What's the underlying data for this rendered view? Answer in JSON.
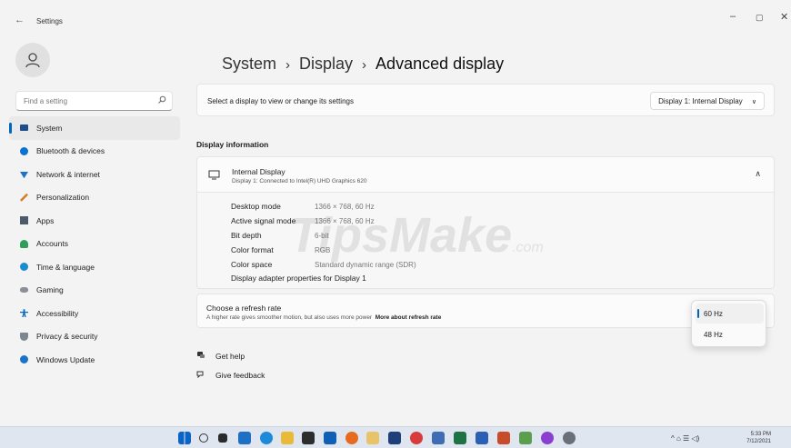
{
  "window": {
    "back": "←",
    "title": "Settings",
    "controls": {
      "minimize": "–",
      "maximize": "▢",
      "close": "✕"
    }
  },
  "search": {
    "placeholder": "Find a setting"
  },
  "sidebar": {
    "items": [
      {
        "label": "System",
        "icon": "monitor-icon",
        "color": "#1f4e8c"
      },
      {
        "label": "Bluetooth & devices",
        "icon": "bluetooth-icon",
        "color": "#0a72d1"
      },
      {
        "label": "Network & internet",
        "icon": "wifi-icon",
        "color": "#1a73c9"
      },
      {
        "label": "Personalization",
        "icon": "brush-icon",
        "color": "#d67d2a"
      },
      {
        "label": "Apps",
        "icon": "apps-icon",
        "color": "#4d5a6b"
      },
      {
        "label": "Accounts",
        "icon": "person-icon",
        "color": "#2e9e5c"
      },
      {
        "label": "Time & language",
        "icon": "globe-icon",
        "color": "#1b8ad1"
      },
      {
        "label": "Gaming",
        "icon": "controller-icon",
        "color": "#8a8f98"
      },
      {
        "label": "Accessibility",
        "icon": "accessibility-icon",
        "color": "#0067c0"
      },
      {
        "label": "Privacy & security",
        "icon": "shield-icon",
        "color": "#7d8590"
      },
      {
        "label": "Windows Update",
        "icon": "update-icon",
        "color": "#1a73c9"
      }
    ]
  },
  "breadcrumb": {
    "parts": [
      "System",
      "Display",
      "Advanced display"
    ],
    "separator": "›"
  },
  "select_display": {
    "label": "Select a display to view or change its settings",
    "value": "Display 1: Internal Display"
  },
  "display_info": {
    "section_title": "Display information",
    "name": "Internal Display",
    "subtitle": "Display 1: Connected to Intel(R) UHD Graphics 620",
    "rows": [
      {
        "key": "Desktop mode",
        "value": "1366 × 768, 60 Hz"
      },
      {
        "key": "Active signal mode",
        "value": "1366 × 768, 60 Hz"
      },
      {
        "key": "Bit depth",
        "value": "6-bit"
      },
      {
        "key": "Color format",
        "value": "RGB"
      },
      {
        "key": "Color space",
        "value": "Standard dynamic range (SDR)"
      }
    ],
    "adapter_link": "Display adapter properties for Display 1"
  },
  "refresh_rate": {
    "title": "Choose a refresh rate",
    "subtitle": "A higher rate gives smoother motion, but also uses more power",
    "link": "More about refresh rate",
    "options": [
      "60 Hz",
      "48 Hz"
    ],
    "selected": "60 Hz"
  },
  "help": {
    "get_help": "Get help",
    "feedback": "Give feedback"
  },
  "watermark": {
    "main": "TipsMake",
    "suffix": ".com"
  },
  "taskbar": {
    "tray": "^  ⌂  ☰  ◁)",
    "time": "5:33 PM",
    "date": "7/12/2021"
  }
}
